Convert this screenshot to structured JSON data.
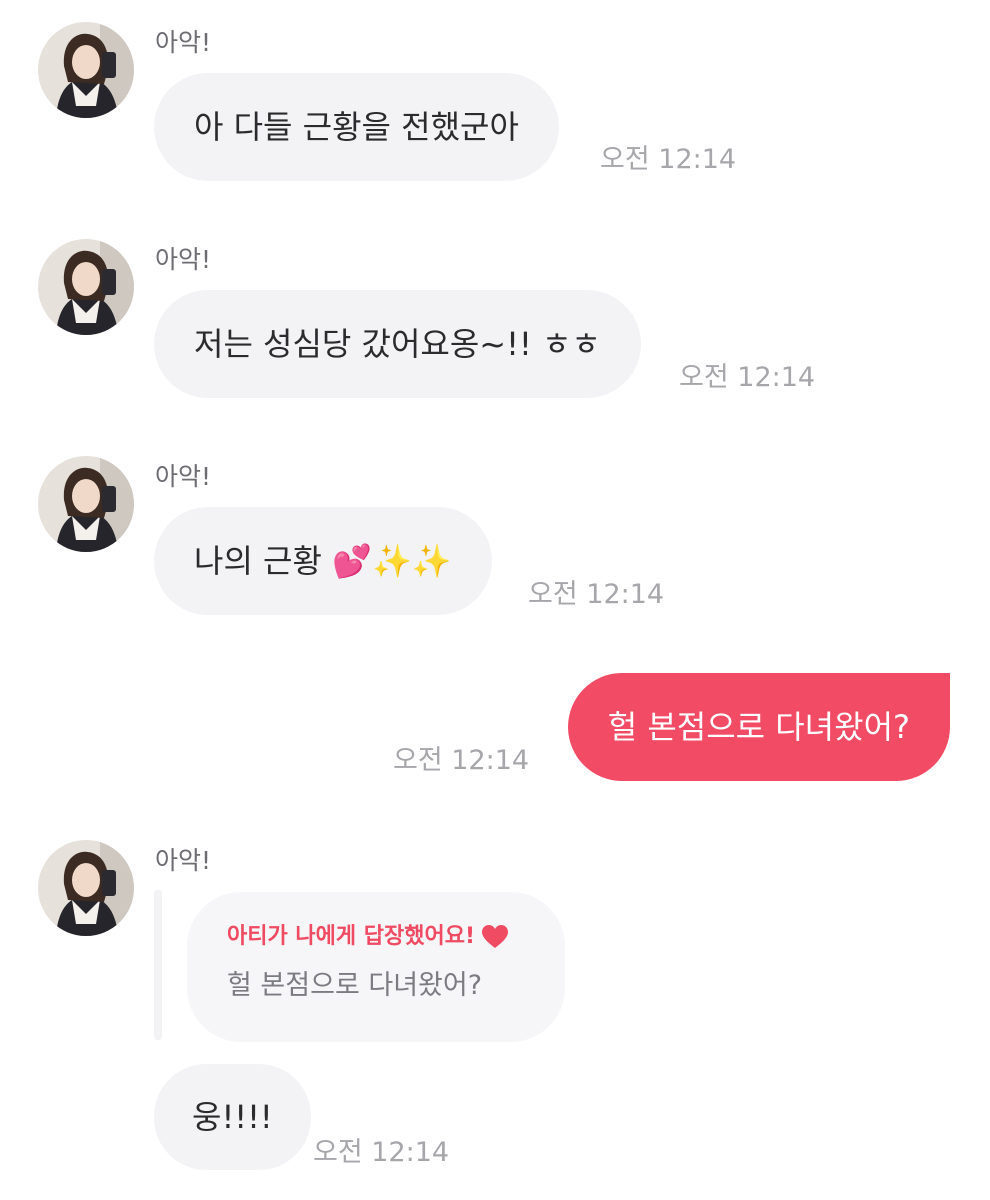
{
  "messages": [
    {
      "sender": "아악!",
      "text": "아 다들 근황을 전했군아",
      "time": "오전 12:14"
    },
    {
      "sender": "아악!",
      "text": "저는 성심당 갔어요옹~!! ㅎㅎ",
      "time": "오전 12:14"
    },
    {
      "sender": "아악!",
      "text": "나의 근황 💕✨✨",
      "time": "오전 12:14"
    },
    {
      "text": "헐 본점으로 다녀왔어?",
      "time": "오전 12:14"
    },
    {
      "sender": "아악!",
      "reply_label": "아티가 나에게 답장했어요!",
      "reply_quote": "헐 본점으로 다녀왔어?",
      "text": "웅!!!!",
      "time": "오전 12:14"
    }
  ],
  "colors": {
    "outgoing_bubble": "#f24b66",
    "incoming_bubble": "#f3f3f6",
    "reply_accent": "#ef4b63",
    "timestamp": "#a6a6ab"
  },
  "icons": {
    "reply_heart": "heart-icon"
  }
}
